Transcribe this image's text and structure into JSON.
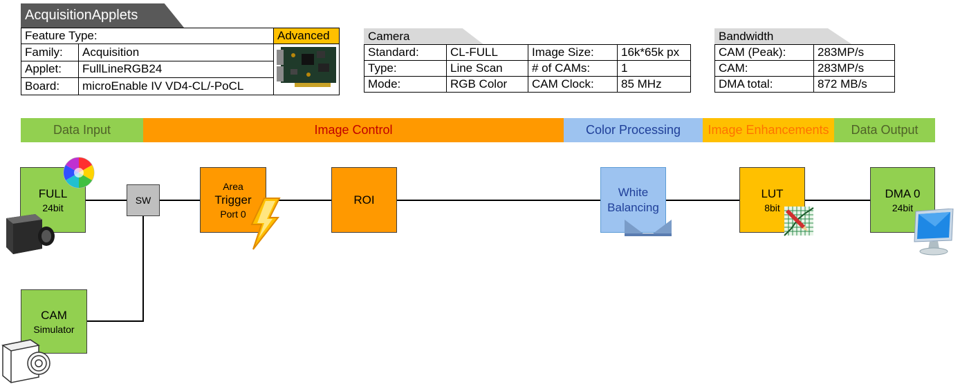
{
  "header": {
    "title": "AcquisitionApplets"
  },
  "feature": {
    "label": "Feature Type:",
    "value": "Advanced",
    "rows": [
      {
        "label": "Family:",
        "value": "Acquisition"
      },
      {
        "label": "Applet:",
        "value": "FullLineRGB24"
      },
      {
        "label": "Board:",
        "value": "microEnable IV VD4-CL/-PoCL"
      }
    ]
  },
  "camera": {
    "title": "Camera",
    "rows": [
      {
        "l1": "Standard:",
        "v1": "CL-FULL",
        "l2": "Image Size:",
        "v2": "16k*65k px"
      },
      {
        "l1": "Type:",
        "v1": "Line Scan",
        "l2": "# of CAMs:",
        "v2": "1"
      },
      {
        "l1": "Mode:",
        "v1": "RGB Color",
        "l2": "CAM Clock:",
        "v2": "85 MHz"
      }
    ]
  },
  "bandwidth": {
    "title": "Bandwidth",
    "rows": [
      {
        "label": "CAM (Peak):",
        "value": "283MP/s"
      },
      {
        "label": "CAM:",
        "value": "283MP/s"
      },
      {
        "label": "DMA total:",
        "value": "872 MB/s"
      }
    ]
  },
  "stages": [
    {
      "label": "Data Input",
      "color": "#92d050",
      "text_color": "#4f6228"
    },
    {
      "label": "Image Control",
      "color": "#ff9900",
      "text_color": "#c00000"
    },
    {
      "label": "Color Processing",
      "color": "#9dc3f0",
      "text_color": "#1f3f99"
    },
    {
      "label": "Image Enhancements",
      "color": "#ffc000",
      "text_color": "#ff7300"
    },
    {
      "label": "Data Output",
      "color": "#92d050",
      "text_color": "#4f6228"
    }
  ],
  "blocks": {
    "full": {
      "line1": "FULL",
      "line2": "24bit"
    },
    "sw": {
      "line1": "SW"
    },
    "trigger": {
      "line1": "Area",
      "line2": "Trigger",
      "line3": "Port 0"
    },
    "roi": {
      "line1": "ROI"
    },
    "white": {
      "line1": "White",
      "line2": "Balancing"
    },
    "lut": {
      "line1": "LUT",
      "line2": "8bit"
    },
    "dma": {
      "line1": "DMA 0",
      "line2": "24bit"
    },
    "cam": {
      "line1": "CAM",
      "line2": "Simulator"
    }
  },
  "icons": [
    "board-photo-icon",
    "color-wheel-icon",
    "camera-icon",
    "lightning-icon",
    "lut-chart-icon",
    "monitor-icon",
    "camera-simulator-icon"
  ]
}
